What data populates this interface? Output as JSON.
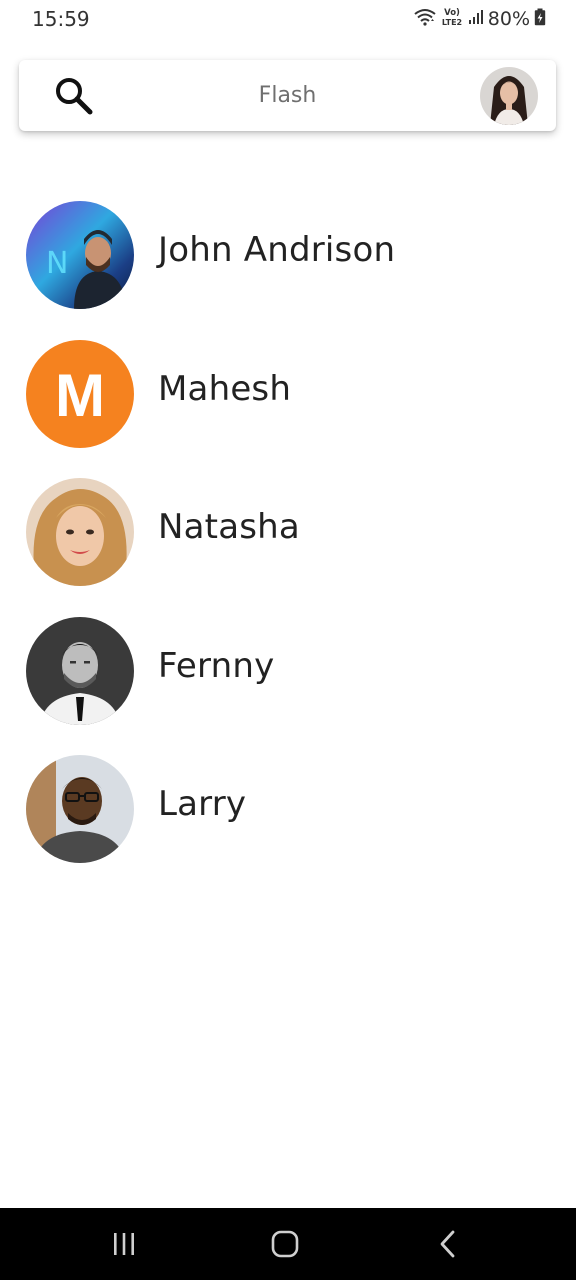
{
  "status_bar": {
    "time": "15:59",
    "battery": "80%",
    "icons": [
      "wifi-icon",
      "volte-lte2-icon",
      "signal-icon",
      "battery-icon"
    ]
  },
  "search": {
    "placeholder": "Flash",
    "icon": "search-icon",
    "profile_avatar": "user-profile-avatar"
  },
  "contacts": [
    {
      "name": "John Andrison",
      "avatar": "photo"
    },
    {
      "name": "Mahesh",
      "avatar": "letter",
      "letter": "M",
      "color": "#F5821F"
    },
    {
      "name": "Natasha",
      "avatar": "photo"
    },
    {
      "name": "Fernny",
      "avatar": "photo"
    },
    {
      "name": "Larry",
      "avatar": "photo"
    }
  ],
  "nav_bar": {
    "buttons": [
      "recent-apps-icon",
      "home-icon",
      "back-icon"
    ]
  },
  "colors": {
    "background": "#FFFFFF",
    "text": "#222222",
    "placeholder": "#6F6F6F",
    "nav_background": "#000000",
    "letter_avatar": "#F5821F"
  }
}
